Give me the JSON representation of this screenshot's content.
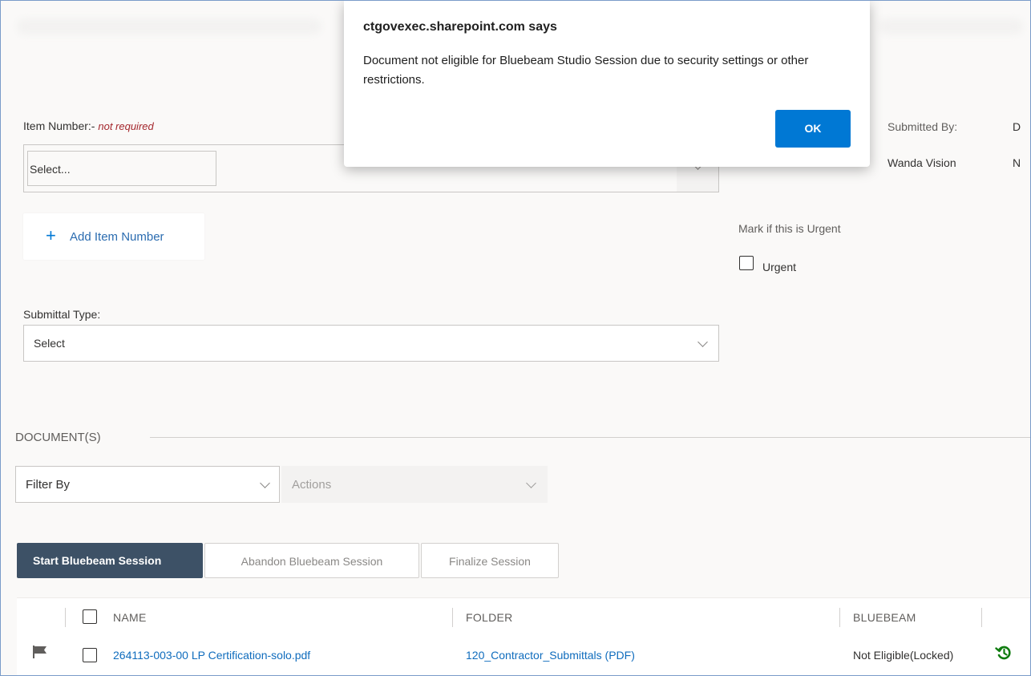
{
  "form": {
    "item_number_label": "Item Number:-",
    "item_number_required": "not required",
    "item_select_placeholder": "Select...",
    "add_item_number": "Add Item Number",
    "submitted_by_label": "Submitted By:",
    "submitted_by_value": "Wanda Vision",
    "cut_col_label": "D",
    "cut_col_value": "N",
    "urgent_prompt": "Mark if this is Urgent",
    "urgent_label": "Urgent",
    "submittal_type_label": "Submittal Type:",
    "submittal_type_value": "Select"
  },
  "documents": {
    "section_title": "DOCUMENT(S)",
    "filter_by": "Filter By",
    "actions": "Actions",
    "buttons": {
      "start": "Start Bluebeam Session",
      "abandon": "Abandon Bluebeam Session",
      "finalize": "Finalize Session"
    },
    "columns": {
      "name": "NAME",
      "folder": "FOLDER",
      "bluebeam": "BLUEBEAM"
    },
    "rows": [
      {
        "name": "264113-003-00 LP Certification-solo.pdf",
        "folder": "120_Contractor_Submittals (PDF)",
        "bluebeam": "Not Eligible(Locked)"
      }
    ]
  },
  "dialog": {
    "title": "ctgovexec.sharepoint.com says",
    "message": "Document not eligible for Bluebeam Studio Session due to security settings or other restrictions.",
    "ok": "OK"
  },
  "colors": {
    "primary_button": "#3d5166",
    "ok_button": "#0078d4",
    "link": "#0f6cbd",
    "history_icon": "#107c10",
    "required_text": "#a4262c"
  }
}
